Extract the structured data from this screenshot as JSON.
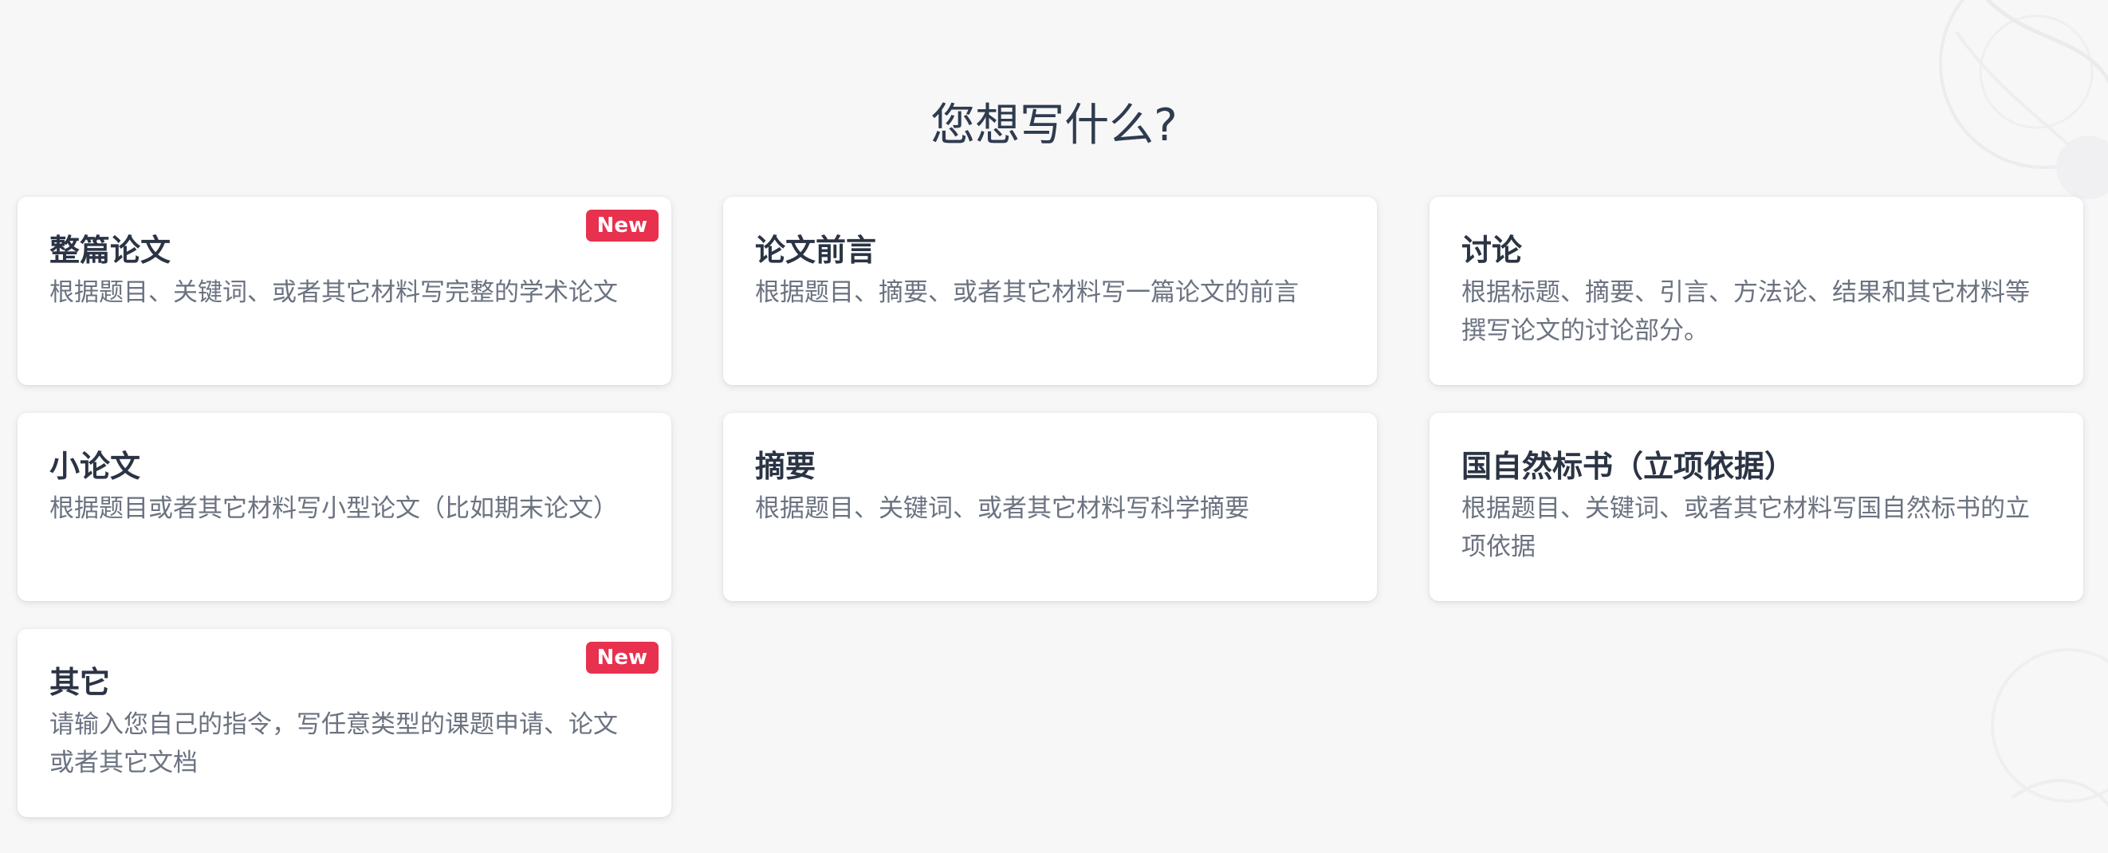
{
  "heading": "您想写什么?",
  "colors": {
    "background": "#f7f7f8",
    "card": "#ffffff",
    "title": "#2b3444",
    "description": "#6b7280",
    "badge": "#e8304f"
  },
  "cards": [
    {
      "title": "整篇论文",
      "description": "根据题目、关键词、或者其它材料写完整的学术论文",
      "badge": "New"
    },
    {
      "title": "论文前言",
      "description": "根据题目、摘要、或者其它材料写一篇论文的前言"
    },
    {
      "title": "讨论",
      "description": "根据标题、摘要、引言、方法论、结果和其它材料等撰写论文的讨论部分。"
    },
    {
      "title": "小论文",
      "description": "根据题目或者其它材料写小型论文（比如期末论文）"
    },
    {
      "title": "摘要",
      "description": "根据题目、关键词、或者其它材料写科学摘要"
    },
    {
      "title": "国自然标书（立项依据）",
      "description": "根据题目、关键词、或者其它材料写国自然标书的立项依据"
    },
    {
      "title": "其它",
      "description": "请输入您自己的指令，写任意类型的课题申请、论文或者其它文档",
      "badge": "New"
    }
  ]
}
